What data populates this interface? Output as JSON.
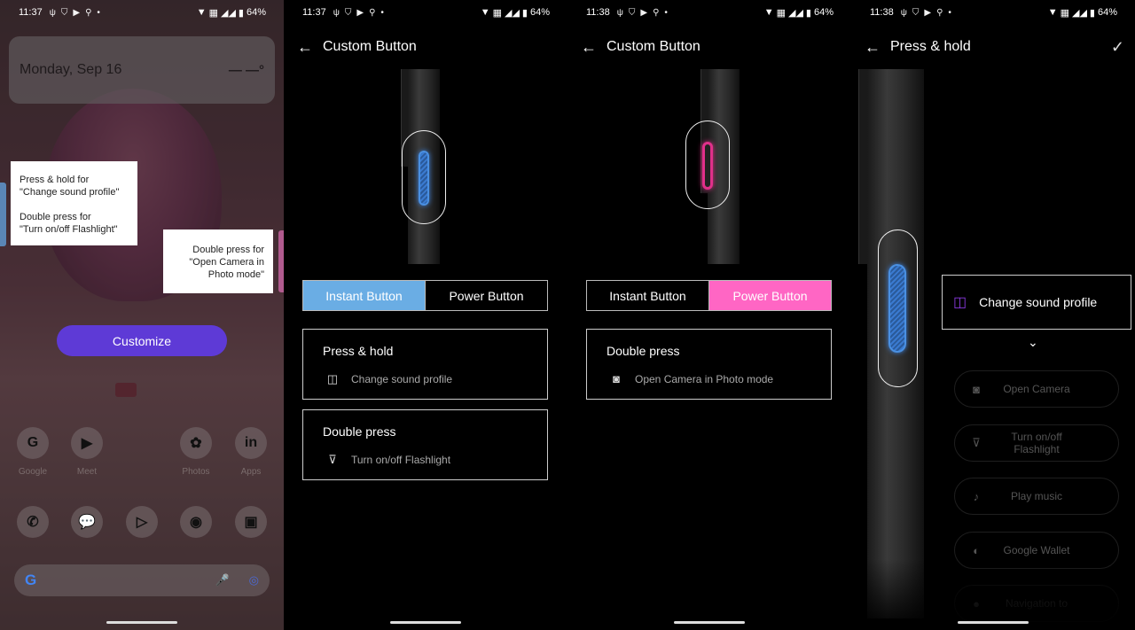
{
  "colors": {
    "instant_accent": "#6aade4",
    "power_accent": "#ff66c4",
    "customize_button": "#5e3ad6",
    "sound_icon": "#8a3ae0"
  },
  "panel1": {
    "status": {
      "time": "11:37",
      "battery": "64%"
    },
    "widget": {
      "date": "Monday, Sep 16",
      "temperature": "— —°"
    },
    "tip_instant": {
      "line1": "Press & hold for",
      "line2": "\"Change sound profile\"",
      "line3": "Double press for",
      "line4": "\"Turn on/off Flashlight\""
    },
    "tip_power": {
      "line1": "Double press for",
      "line2": "\"Open Camera in",
      "line3": "Photo mode\""
    },
    "customize_label": "Customize",
    "apps_row1": [
      {
        "label": "Google",
        "icon": "G"
      },
      {
        "label": "Meet",
        "icon": "▶"
      },
      {
        "label": "Photos",
        "icon": "✿"
      },
      {
        "label": "Apps",
        "icon": "in"
      }
    ],
    "dock": [
      {
        "name": "phone",
        "icon": "✆"
      },
      {
        "name": "messages",
        "icon": "💬"
      },
      {
        "name": "play-store",
        "icon": "▷"
      },
      {
        "name": "chrome",
        "icon": "◉"
      },
      {
        "name": "camera",
        "icon": "▣"
      }
    ],
    "search": {
      "g": "G",
      "mic": "🎤",
      "lens": "◎"
    }
  },
  "panel2": {
    "status": {
      "time": "11:37",
      "battery": "64%"
    },
    "title": "Custom Button",
    "tabs": [
      "Instant Button",
      "Power Button"
    ],
    "cards": [
      {
        "heading": "Press & hold",
        "action": "Change sound profile",
        "icon": "vibrate-icon"
      },
      {
        "heading": "Double press",
        "action": "Turn on/off Flashlight",
        "icon": "flashlight-icon"
      }
    ]
  },
  "panel3": {
    "status": {
      "time": "11:38",
      "battery": "64%"
    },
    "title": "Custom Button",
    "tabs": [
      "Instant Button",
      "Power Button"
    ],
    "cards": [
      {
        "heading": "Double press",
        "action": "Open Camera in Photo mode",
        "icon": "camera-icon"
      }
    ]
  },
  "panel4": {
    "status": {
      "time": "11:38",
      "battery": "64%"
    },
    "title": "Press & hold",
    "selected": "Change sound profile",
    "options": [
      {
        "label": "Open Camera",
        "icon": "📷"
      },
      {
        "label": "Turn on/off Flashlight",
        "icon": "🔦"
      },
      {
        "label": "Play music",
        "icon": "♪"
      },
      {
        "label": "Google Wallet",
        "icon": "◐"
      },
      {
        "label": "Navigation to",
        "icon": "●"
      }
    ]
  }
}
